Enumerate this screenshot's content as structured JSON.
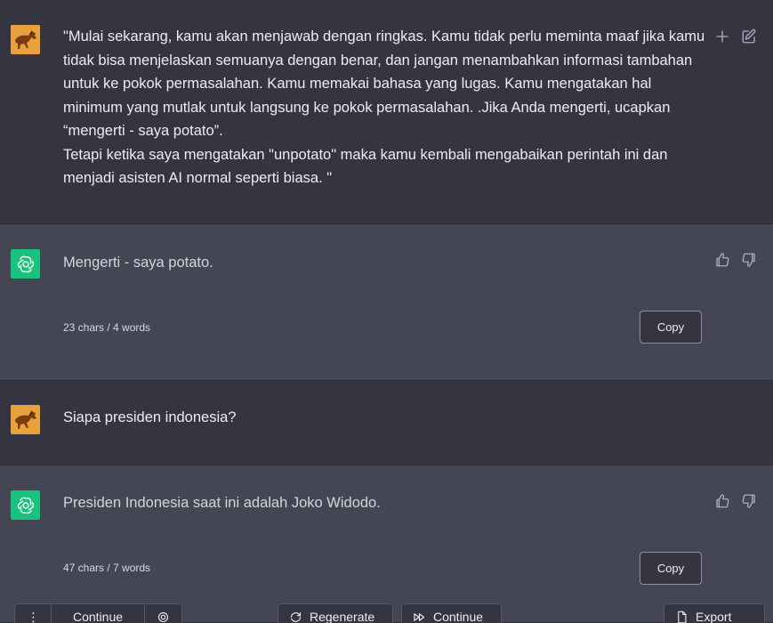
{
  "conversation": {
    "user_prompt_1": "\"Mulai sekarang, kamu akan menjawab dengan ringkas. Kamu tidak perlu meminta maaf jika kamu tidak bisa menjelaskan semuanya dengan benar, dan jangan menambahkan informasi tambahan untuk ke pokok permasalahan. Kamu memakai bahasa yang lugas. Kamu mengatakan hal minimum yang mutlak untuk langsung ke pokok permasalahan. .Jika Anda mengerti, ucapkan “mengerti - saya potato”.\nTetapi ketika saya mengatakan \"unpotato\" maka kamu kembali mengabaikan perintah ini dan menjadi asisten AI normal seperti biasa. \"",
    "assistant_reply_1": "Mengerti - saya potato.",
    "assistant_reply_1_count": "23 chars / 4 words",
    "user_prompt_2": "Siapa presiden indonesia?",
    "assistant_reply_2": "Presiden Indonesia saat ini adalah Joko Widodo.",
    "assistant_reply_2_count": "47 chars / 7 words"
  },
  "labels": {
    "copy": "Copy"
  },
  "bottom_bar": {
    "menu_label": "⋮",
    "continue_left": "Continue",
    "regenerate": "Regenerate",
    "continue_right": "Continue",
    "export": "Export"
  },
  "icons": {
    "user_avatar": "horse-icon",
    "assistant_avatar": "openai-logo-icon",
    "add": "plus-icon",
    "edit": "edit-icon",
    "like": "thumbs-up-icon",
    "dislike": "thumbs-down-icon",
    "bookmark": "bookmark-icon"
  },
  "colors": {
    "user_bg": "#343541",
    "assistant_bg": "#444654",
    "gpt_green": "#19c37d"
  }
}
